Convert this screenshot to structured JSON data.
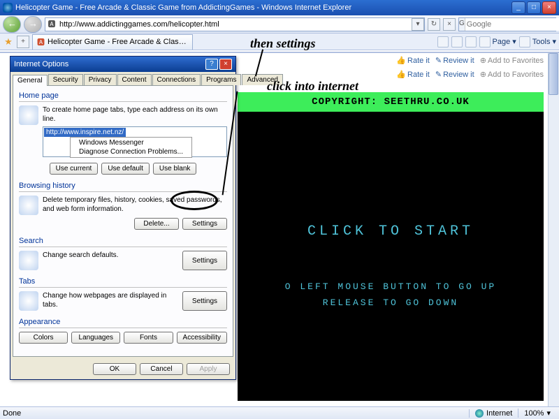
{
  "titlebar": {
    "title": "Helicopter Game - Free Arcade & Classic Game from AddictingGames - Windows Internet Explorer"
  },
  "address": {
    "url": "http://www.addictinggames.com/helicopter.html"
  },
  "searchbox": {
    "placeholder": "Google"
  },
  "tab": {
    "label": "Helicopter Game - Free Arcade & Classic Game from A..."
  },
  "toolbarmenu": {
    "page": "Page",
    "tools": "Tools"
  },
  "annotations": {
    "a1": "then settings",
    "a2": "click into internet"
  },
  "page_actions": {
    "rate": "Rate it",
    "review": "Review it",
    "fav": "Add to Favorites"
  },
  "game": {
    "copyright": "COPYRIGHT: SEETHRU.CO.UK",
    "start": "CLICK TO START",
    "instr1": "O LEFT MOUSE BUTTON TO GO UP",
    "instr2": "RELEASE TO GO DOWN"
  },
  "dialog": {
    "title": "Internet Options",
    "tabs": [
      "General",
      "Security",
      "Privacy",
      "Content",
      "Connections",
      "Programs",
      "Advanced"
    ],
    "home": {
      "label": "Home page",
      "text": "To create home page tabs, type each address on its own line.",
      "url": "http://www.inspire.net.nz/",
      "menu1": "Windows Messenger",
      "menu2": "Diagnose Connection Problems...",
      "b1": "Use current",
      "b2": "Use default",
      "b3": "Use blank"
    },
    "history": {
      "label": "Browsing history",
      "text": "Delete temporary files, history, cookies, saved passwords, and web form information.",
      "b1": "Delete...",
      "b2": "Settings"
    },
    "search": {
      "label": "Search",
      "text": "Change search defaults.",
      "b1": "Settings"
    },
    "tabsg": {
      "label": "Tabs",
      "text": "Change how webpages are displayed in tabs.",
      "b1": "Settings"
    },
    "appear": {
      "label": "Appearance",
      "b1": "Colors",
      "b2": "Languages",
      "b3": "Fonts",
      "b4": "Accessibility"
    },
    "foot": {
      "ok": "OK",
      "cancel": "Cancel",
      "apply": "Apply"
    }
  },
  "status": {
    "done": "Done",
    "zone": "Internet",
    "zoom": "100%"
  }
}
